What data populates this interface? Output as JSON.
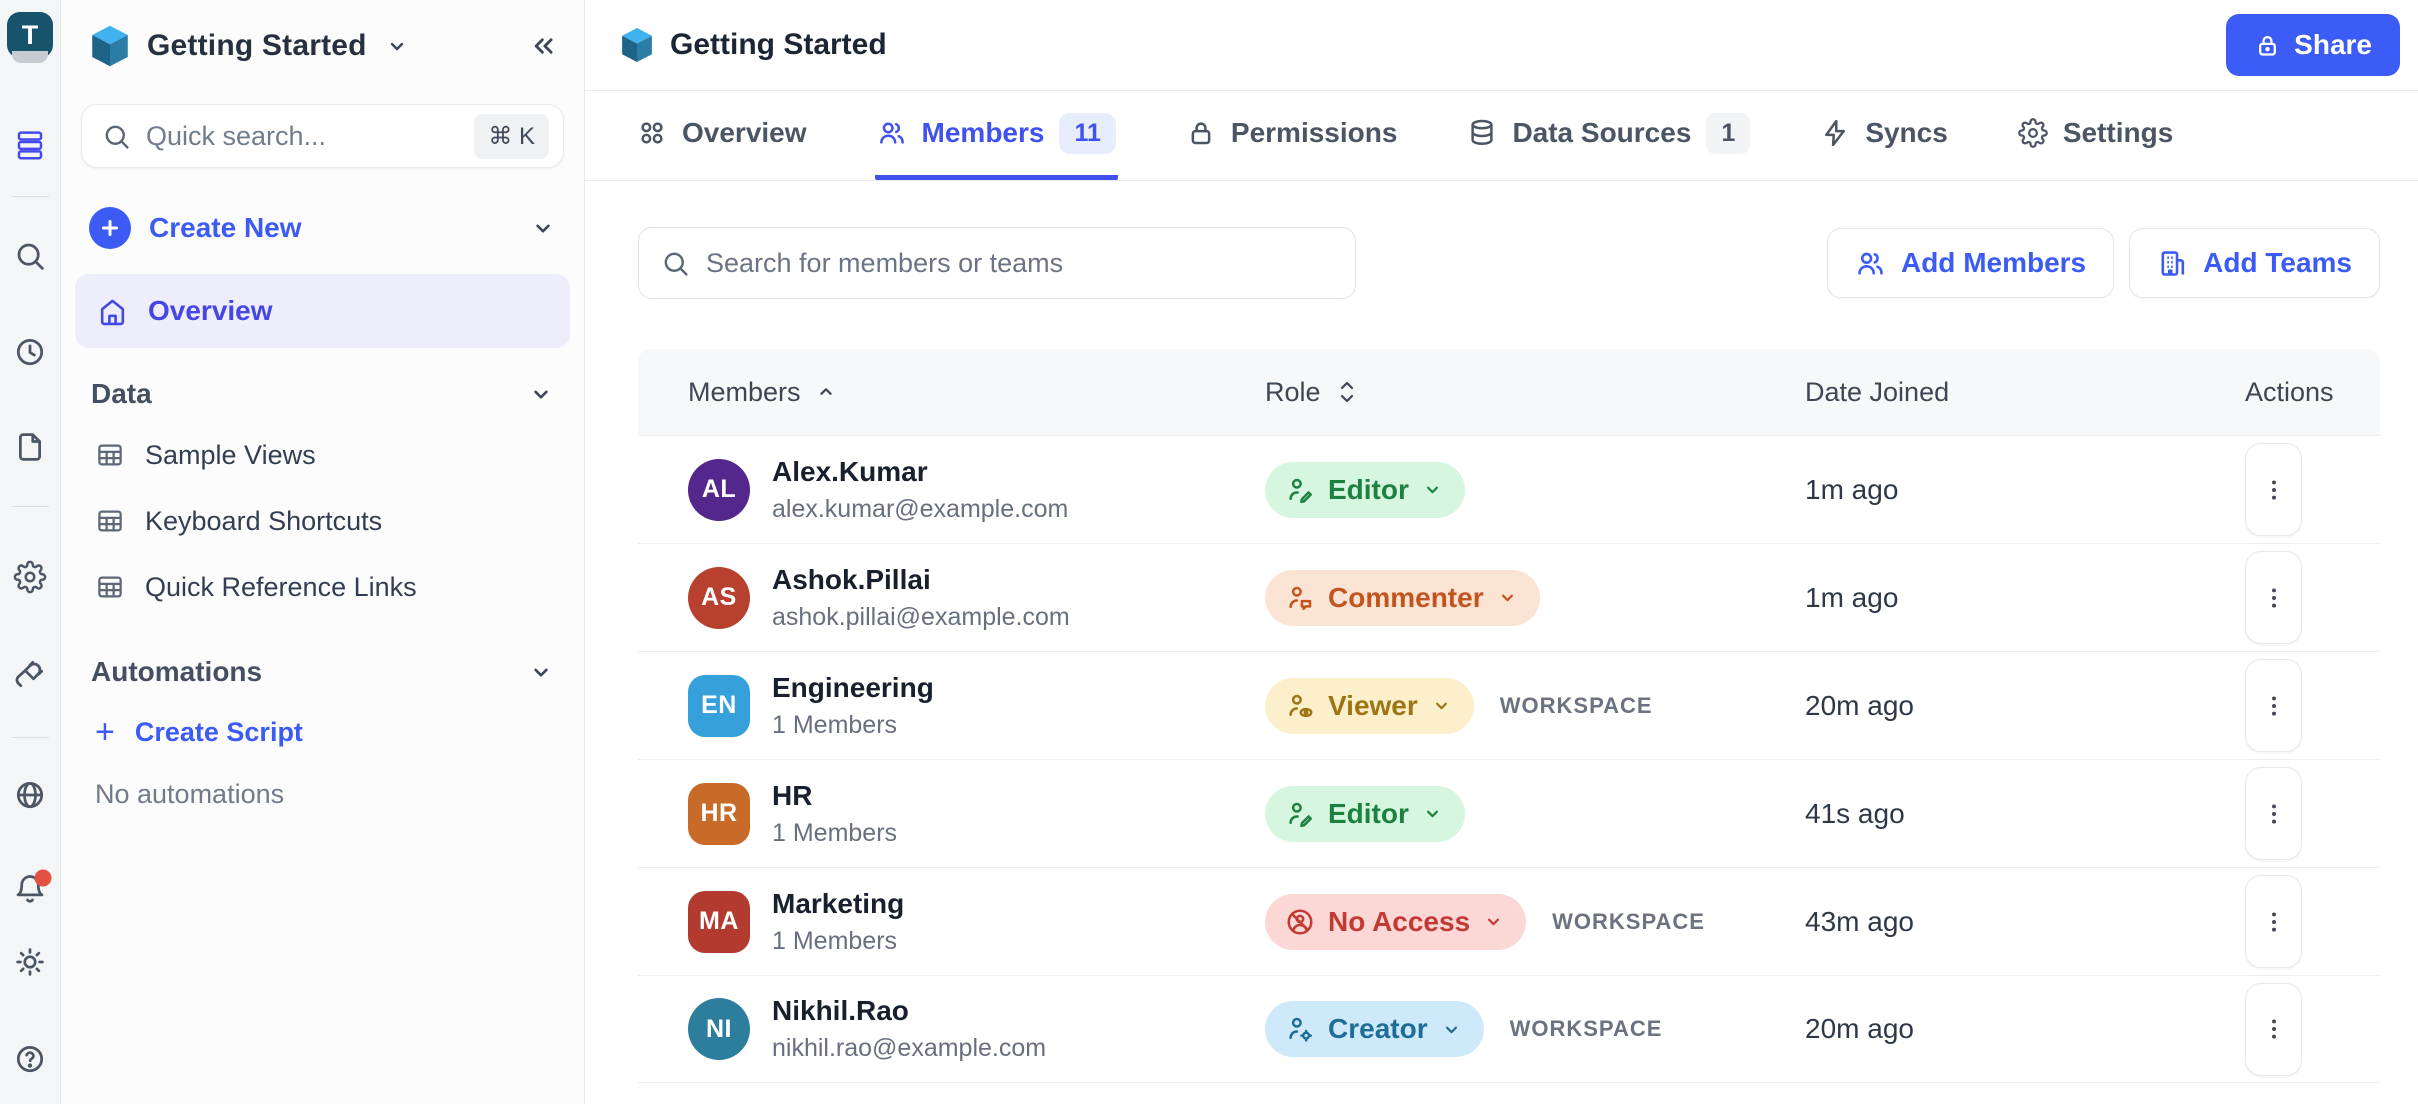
{
  "app": {
    "logo_letter": "T"
  },
  "rail": {
    "icons": [
      "workspace-logo",
      "layers",
      "search",
      "recent",
      "documents",
      "settings",
      "integrations",
      "globe",
      "notifications",
      "theme-toggle",
      "help"
    ]
  },
  "sidebar": {
    "workspace_name": "Getting Started",
    "search": {
      "placeholder": "Quick search...",
      "shortcut": "⌘ K"
    },
    "create_new_label": "Create New",
    "overview_label": "Overview",
    "data_section": {
      "label": "Data",
      "items": [
        {
          "label": "Sample Views"
        },
        {
          "label": "Keyboard Shortcuts"
        },
        {
          "label": "Quick Reference Links"
        }
      ]
    },
    "automations_section": {
      "label": "Automations",
      "create_script_label": "Create Script",
      "empty_text": "No automations"
    }
  },
  "header": {
    "title": "Getting Started",
    "share_label": "Share"
  },
  "tabs": {
    "items": [
      {
        "label": "Overview"
      },
      {
        "label": "Members",
        "badge": "11",
        "active": true
      },
      {
        "label": "Permissions"
      },
      {
        "label": "Data Sources",
        "badge": "1"
      },
      {
        "label": "Syncs"
      },
      {
        "label": "Settings"
      }
    ]
  },
  "toolbar": {
    "search_placeholder": "Search for members or teams",
    "add_members_label": "Add Members",
    "add_teams_label": "Add Teams"
  },
  "members_table": {
    "columns": {
      "members": "Members",
      "role": "Role",
      "date_joined": "Date Joined",
      "actions": "Actions"
    },
    "workspace_tag": "WORKSPACE",
    "rows": [
      {
        "initials": "AL",
        "name": "Alex.Kumar",
        "subtitle": "alex.kumar@example.com",
        "role": "Editor",
        "scope": "",
        "date_joined": "1m ago",
        "avatar_color": "#53278b",
        "role_bg": "#d7f6e0",
        "role_fg": "#1d8240",
        "type": "user"
      },
      {
        "initials": "AS",
        "name": "Ashok.Pillai",
        "subtitle": "ashok.pillai@example.com",
        "role": "Commenter",
        "scope": "",
        "date_joined": "1m ago",
        "avatar_color": "#b8402f",
        "role_bg": "#fce4d4",
        "role_fg": "#c2541f",
        "type": "user"
      },
      {
        "initials": "EN",
        "name": "Engineering",
        "subtitle": "1 Members",
        "role": "Viewer",
        "scope": "WORKSPACE",
        "date_joined": "20m ago",
        "avatar_color": "#35a0da",
        "role_bg": "#fcf0cc",
        "role_fg": "#9d7512",
        "type": "team"
      },
      {
        "initials": "HR",
        "name": "HR",
        "subtitle": "1 Members",
        "role": "Editor",
        "scope": "",
        "date_joined": "41s ago",
        "avatar_color": "#c96b28",
        "role_bg": "#d7f6e0",
        "role_fg": "#1d8240",
        "type": "team"
      },
      {
        "initials": "MA",
        "name": "Marketing",
        "subtitle": "1 Members",
        "role": "No Access",
        "scope": "WORKSPACE",
        "date_joined": "43m ago",
        "avatar_color": "#b33a2e",
        "role_bg": "#fbd8d6",
        "role_fg": "#c33a34",
        "type": "team"
      },
      {
        "initials": "NI",
        "name": "Nikhil.Rao",
        "subtitle": "nikhil.rao@example.com",
        "role": "Creator",
        "scope": "WORKSPACE",
        "date_joined": "20m ago",
        "avatar_color": "#2d7e9d",
        "role_bg": "#ceeafa",
        "role_fg": "#1e6d98",
        "type": "user"
      }
    ]
  },
  "colors": {
    "accent_blue": "#3b5cf6",
    "active_tab_blue": "#3f51ee",
    "sidebar_active_bg": "#ededfc",
    "rail_bg": "#f4f5f6",
    "table_header_bg": "#f7f8f9",
    "notification_dot": "#e25242",
    "logo_bg": "#17536a"
  }
}
